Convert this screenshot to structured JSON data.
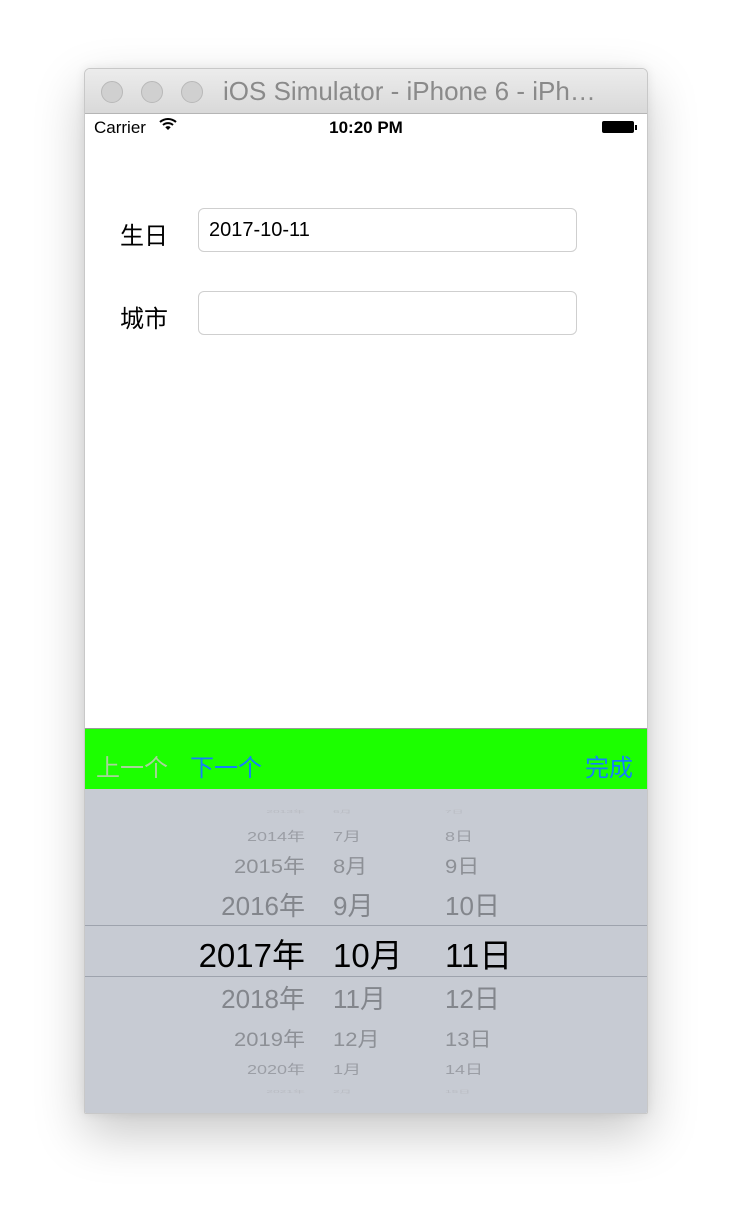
{
  "window": {
    "title": "iOS Simulator - iPhone 6 - iPh…"
  },
  "status_bar": {
    "carrier": "Carrier",
    "time": "10:20 PM"
  },
  "form": {
    "birthday_label": "生日",
    "birthday_value": "2017-10-11",
    "city_label": "城市",
    "city_value": ""
  },
  "toolbar": {
    "prev_label": "上一个",
    "next_label": "下一个",
    "done_label": "完成",
    "background_color": "#1cff00",
    "button_color": "#157efb",
    "disabled_color": "#a8d39c"
  },
  "picker": {
    "rows": [
      {
        "year": "2013年",
        "month": "6月",
        "day": "7日"
      },
      {
        "year": "2014年",
        "month": "7月",
        "day": "8日"
      },
      {
        "year": "2015年",
        "month": "8月",
        "day": "9日"
      },
      {
        "year": "2016年",
        "month": "9月",
        "day": "10日"
      },
      {
        "year": "2017年",
        "month": "10月",
        "day": "11日"
      },
      {
        "year": "2018年",
        "month": "11月",
        "day": "12日"
      },
      {
        "year": "2019年",
        "month": "12月",
        "day": "13日"
      },
      {
        "year": "2020年",
        "month": "1月",
        "day": "14日"
      },
      {
        "year": "2021年",
        "month": "2月",
        "day": "15日"
      }
    ],
    "selected_index": 4
  }
}
